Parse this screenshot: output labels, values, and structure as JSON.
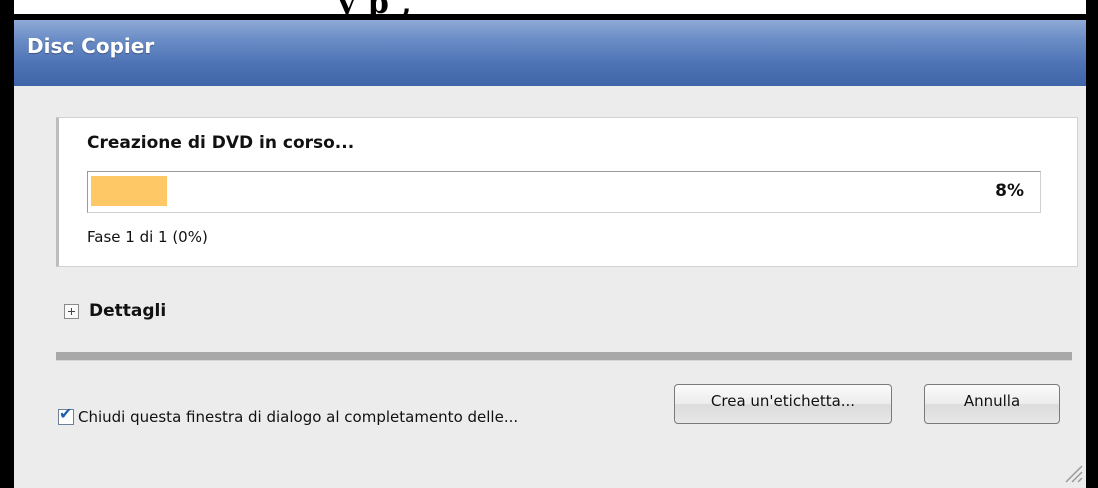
{
  "crop_text": "y     p                    ,",
  "window": {
    "title": "Disc Copier"
  },
  "progress": {
    "status": "Creazione di DVD in corso...",
    "percent_label": "8%",
    "fraction": 0.08,
    "phase": "Fase 1 di 1  (0%)"
  },
  "details": {
    "label": "Dettagli",
    "icon": "plus-expand-icon"
  },
  "close_option": {
    "checked": true,
    "label": "Chiudi questa finestra di dialogo al completamento delle..."
  },
  "buttons": {
    "create_label": "Crea un'etichetta...",
    "cancel": "Annulla"
  },
  "colors": {
    "title_bar": "#4f74b6",
    "progress_fill": "#ffc866",
    "window_bg": "#ececec"
  }
}
